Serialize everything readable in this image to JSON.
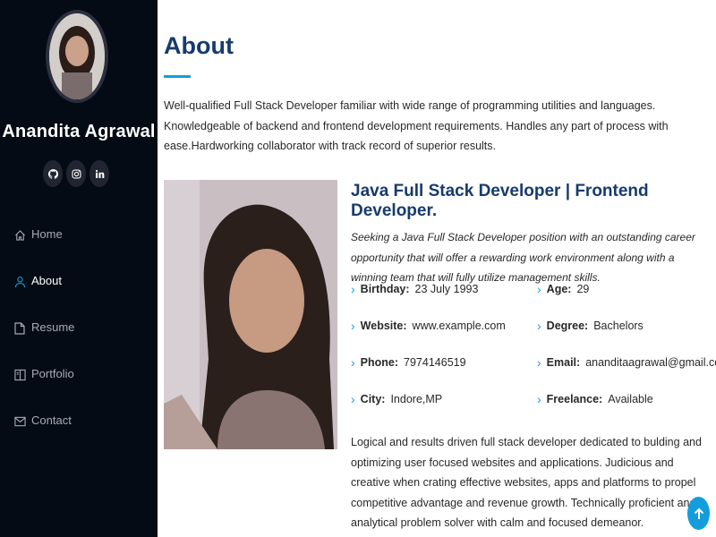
{
  "sidebar": {
    "name": "Anandita Agrawal",
    "social": [
      {
        "icon": "github-icon"
      },
      {
        "icon": "instagram-icon"
      },
      {
        "icon": "linkedin-icon"
      }
    ],
    "nav": [
      {
        "label": "Home",
        "icon": "home-icon"
      },
      {
        "label": "About",
        "icon": "user-icon",
        "active": true
      },
      {
        "label": "Resume",
        "icon": "file-icon"
      },
      {
        "label": "Portfolio",
        "icon": "book-icon"
      },
      {
        "label": "Contact",
        "icon": "envelope-icon"
      }
    ]
  },
  "about": {
    "title": "About",
    "intro": "Well-qualified Full Stack Developer familiar with wide range of programming utilities and languages. Knowledgeable of backend and frontend development requirements. Handles any part of process with ease.Hardworking collaborator with track record of superior results.",
    "role": "Java Full Stack Developer | Frontend Developer.",
    "tagline": "Seeking a Java Full Stack Developer position with an outstanding career opportunity that will offer a rewarding work environment along with a winning team that will fully utilize management skills.",
    "details": [
      {
        "label": "Birthday:",
        "value": "23 July 1993"
      },
      {
        "label": "Age:",
        "value": "29"
      },
      {
        "label": "Website:",
        "value": "www.example.com"
      },
      {
        "label": "Degree:",
        "value": "Bachelors"
      },
      {
        "label": "Phone:",
        "value": "7974146519"
      },
      {
        "label": "Email:",
        "value": "ananditaagrawal@gmail.com"
      },
      {
        "label": "City:",
        "value": "Indore,MP"
      },
      {
        "label": "Freelance:",
        "value": "Available"
      }
    ],
    "summary": "Logical and results driven full stack developer dedicated to bulding and optimizing user focused websites and applications. Judicious and creative when crating effective websites, apps and platforms to propel competitive advantage and revenue growth. Technically proficient and analytical problem solver with calm and focused demeanor."
  },
  "colors": {
    "sidebar_bg": "#040b14",
    "accent": "#149ddd",
    "heading": "#173b6c"
  }
}
